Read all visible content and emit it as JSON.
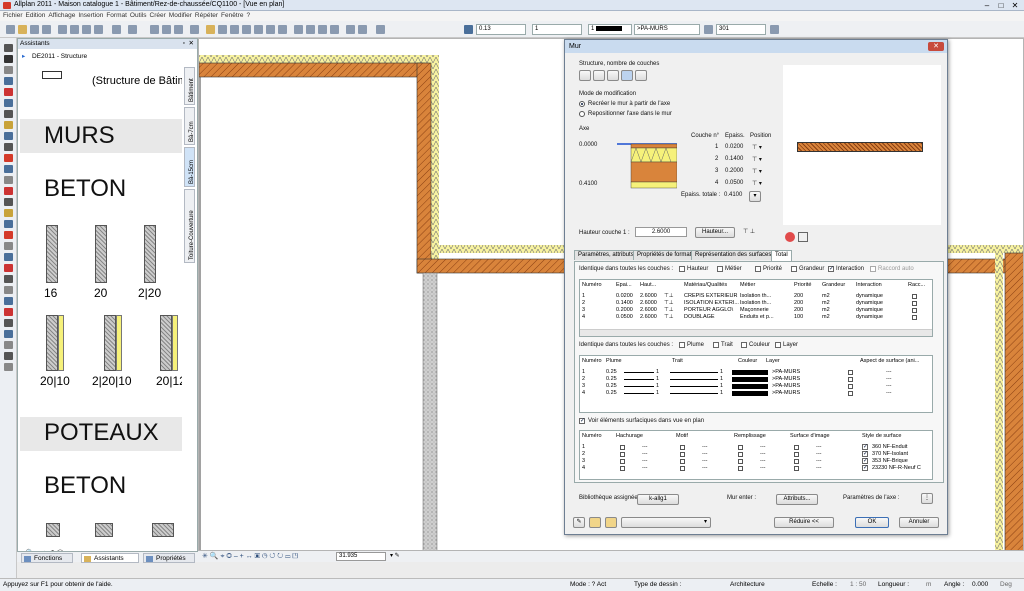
{
  "app": {
    "title": "Allplan 2011 - Maison catalogue 1 - Bâtiment/Rez-de-chaussée/CQ1100 - [Vue en plan]",
    "menu": [
      "Fichier",
      "Edition",
      "Affichage",
      "Insertion",
      "Format",
      "Outils",
      "Créer",
      "Modifier",
      "Répéter",
      "Fenêtre",
      "?"
    ]
  },
  "toolbar": {
    "pen_value": "0.13",
    "line_value": "1",
    "color_value": "1",
    "layer_value": ">PA-MURS",
    "pattern_value": "301"
  },
  "assistant": {
    "title": "Assistants",
    "sub": "DE2011 - Structure",
    "top_text": "(Structure de Bâtime",
    "headings": [
      "MURS",
      "BETON",
      "POTEAUX",
      "BETON"
    ],
    "wall_labels_1": [
      "16",
      "20",
      "2|20"
    ],
    "wall_labels_2": [
      "20|10",
      "2|20|10",
      "20|12"
    ],
    "vtabs": [
      "Bâtiment",
      "Bâ-7cm",
      "Bâ-15cm",
      "Toiture-Couverture"
    ],
    "bottom_tabs": [
      "Fonctions",
      "Assistants",
      "Propriétés"
    ]
  },
  "viewbar": {
    "zoom": "31.935"
  },
  "status": {
    "help": "Appuyez sur F1 pour obtenir de l'aide.",
    "mode": "Mode : ? Act",
    "type_dessin": "Type de dessin :",
    "type_value": "Architecture",
    "echelle": "Echelle :",
    "echelle_value": "1 : 50",
    "longueur": "Longueur :",
    "longueur_unit": "m",
    "angle": "Angle :",
    "angle_value": "0.000",
    "angle_unit": "Deg"
  },
  "dialog": {
    "title": "Mur",
    "structure_label": "Structure, nombre de couches",
    "mode_label": "Mode de modification",
    "mode_options": [
      "Recréer le mur à partir de l'axe",
      "Repositionner l'axe dans le mur"
    ],
    "axe_label": "Axe",
    "axe_top": "0.0000",
    "axe_bottom": "0.4100",
    "layer_head": [
      "Couche n°",
      "Epaiss.",
      "Position"
    ],
    "layers": [
      {
        "n": "1",
        "ep": "0.0200"
      },
      {
        "n": "2",
        "ep": "0.1400"
      },
      {
        "n": "3",
        "ep": "0.2000"
      },
      {
        "n": "4",
        "ep": "0.0500"
      }
    ],
    "epaiss_totale_label": "Epaiss. totale :",
    "epaiss_totale": "0.4100",
    "hauteur_label": "Hauteur couche 1 :",
    "hauteur_value": "2.6000",
    "hauteur_btn": "Hauteur...",
    "tabs": [
      "Paramètres, attributs",
      "Propriétés de format",
      "Représentation des surfaces",
      "Total"
    ],
    "ident1_label": "Identique dans toutes les couches :",
    "ident1": [
      "Hauteur",
      "Métier",
      "Priorité",
      "Grandeur",
      "Interaction",
      "Raccord auto"
    ],
    "t1_head": [
      "Numéro",
      "Epai...",
      "Haut...",
      "",
      "Matériau/Qualités",
      "Métier",
      "Priorité",
      "Grandeur",
      "Interaction",
      "Racc..."
    ],
    "t1_rows": [
      [
        "1",
        "0.0200",
        "2.6000",
        "CREPIS EXTERIEUR",
        "Isolation th...",
        "200",
        "m2",
        "dynamique"
      ],
      [
        "2",
        "0.1400",
        "2.6000",
        "ISOLATION EXTERI...",
        "Isolation th...",
        "200",
        "m2",
        "dynamique"
      ],
      [
        "3",
        "0.2000",
        "2.6000",
        "PORTEUR AGGLO\\",
        "Maçonnerie",
        "200",
        "m2",
        "dynamique"
      ],
      [
        "4",
        "0.0500",
        "2.6000",
        "DOUBLAGE",
        "Enduits et p...",
        "100",
        "m2",
        "dynamique"
      ]
    ],
    "ident2_label": "Identique dans toutes les couches :",
    "ident2": [
      "Plume",
      "Trait",
      "Couleur",
      "Layer"
    ],
    "t2_head": [
      "Numéro",
      "Plume",
      "Trait",
      "Couleur",
      "Layer",
      "Aspect de surface (ani..."
    ],
    "t2_rows": [
      [
        "1",
        "0.25",
        "1",
        "1",
        ">PA-MURS",
        "---"
      ],
      [
        "2",
        "0.25",
        "1",
        "1",
        ">PA-MURS",
        "---"
      ],
      [
        "3",
        "0.25",
        "1",
        "1",
        ">PA-MURS",
        "---"
      ],
      [
        "4",
        "0.25",
        "1",
        "1",
        ">PA-MURS",
        "---"
      ]
    ],
    "voir_label": "Voir éléments surfaciques dans vue en plan",
    "t3_head": [
      "Numéro",
      "Hachurage",
      "Motif",
      "Remplissage",
      "Surface d'image",
      "Style de surface"
    ],
    "t3_rows": [
      [
        "1",
        "---",
        "---",
        "---",
        "---",
        "360 NF-Enduit"
      ],
      [
        "2",
        "---",
        "---",
        "---",
        "---",
        "370 NF-Isolant"
      ],
      [
        "3",
        "---",
        "---",
        "---",
        "---",
        "353 NF-Brique"
      ],
      [
        "4",
        "---",
        "---",
        "---",
        "---",
        "23230 NF-R-Neuf C"
      ]
    ],
    "biblio_label": "Bibliothèque assignée",
    "biblio_btn": "k-allg1",
    "mur_enter": "Mur enter :",
    "attributs_btn": "Attributs...",
    "param_face": "Paramètres de l'axe :",
    "reduire_btn": "Réduire <<",
    "ok_btn": "OK",
    "annuler_btn": "Annuler"
  },
  "colors": {
    "wall_hatch": "#d9843b",
    "insulation": "#f6f17a",
    "accent": "#3c6fb5"
  }
}
